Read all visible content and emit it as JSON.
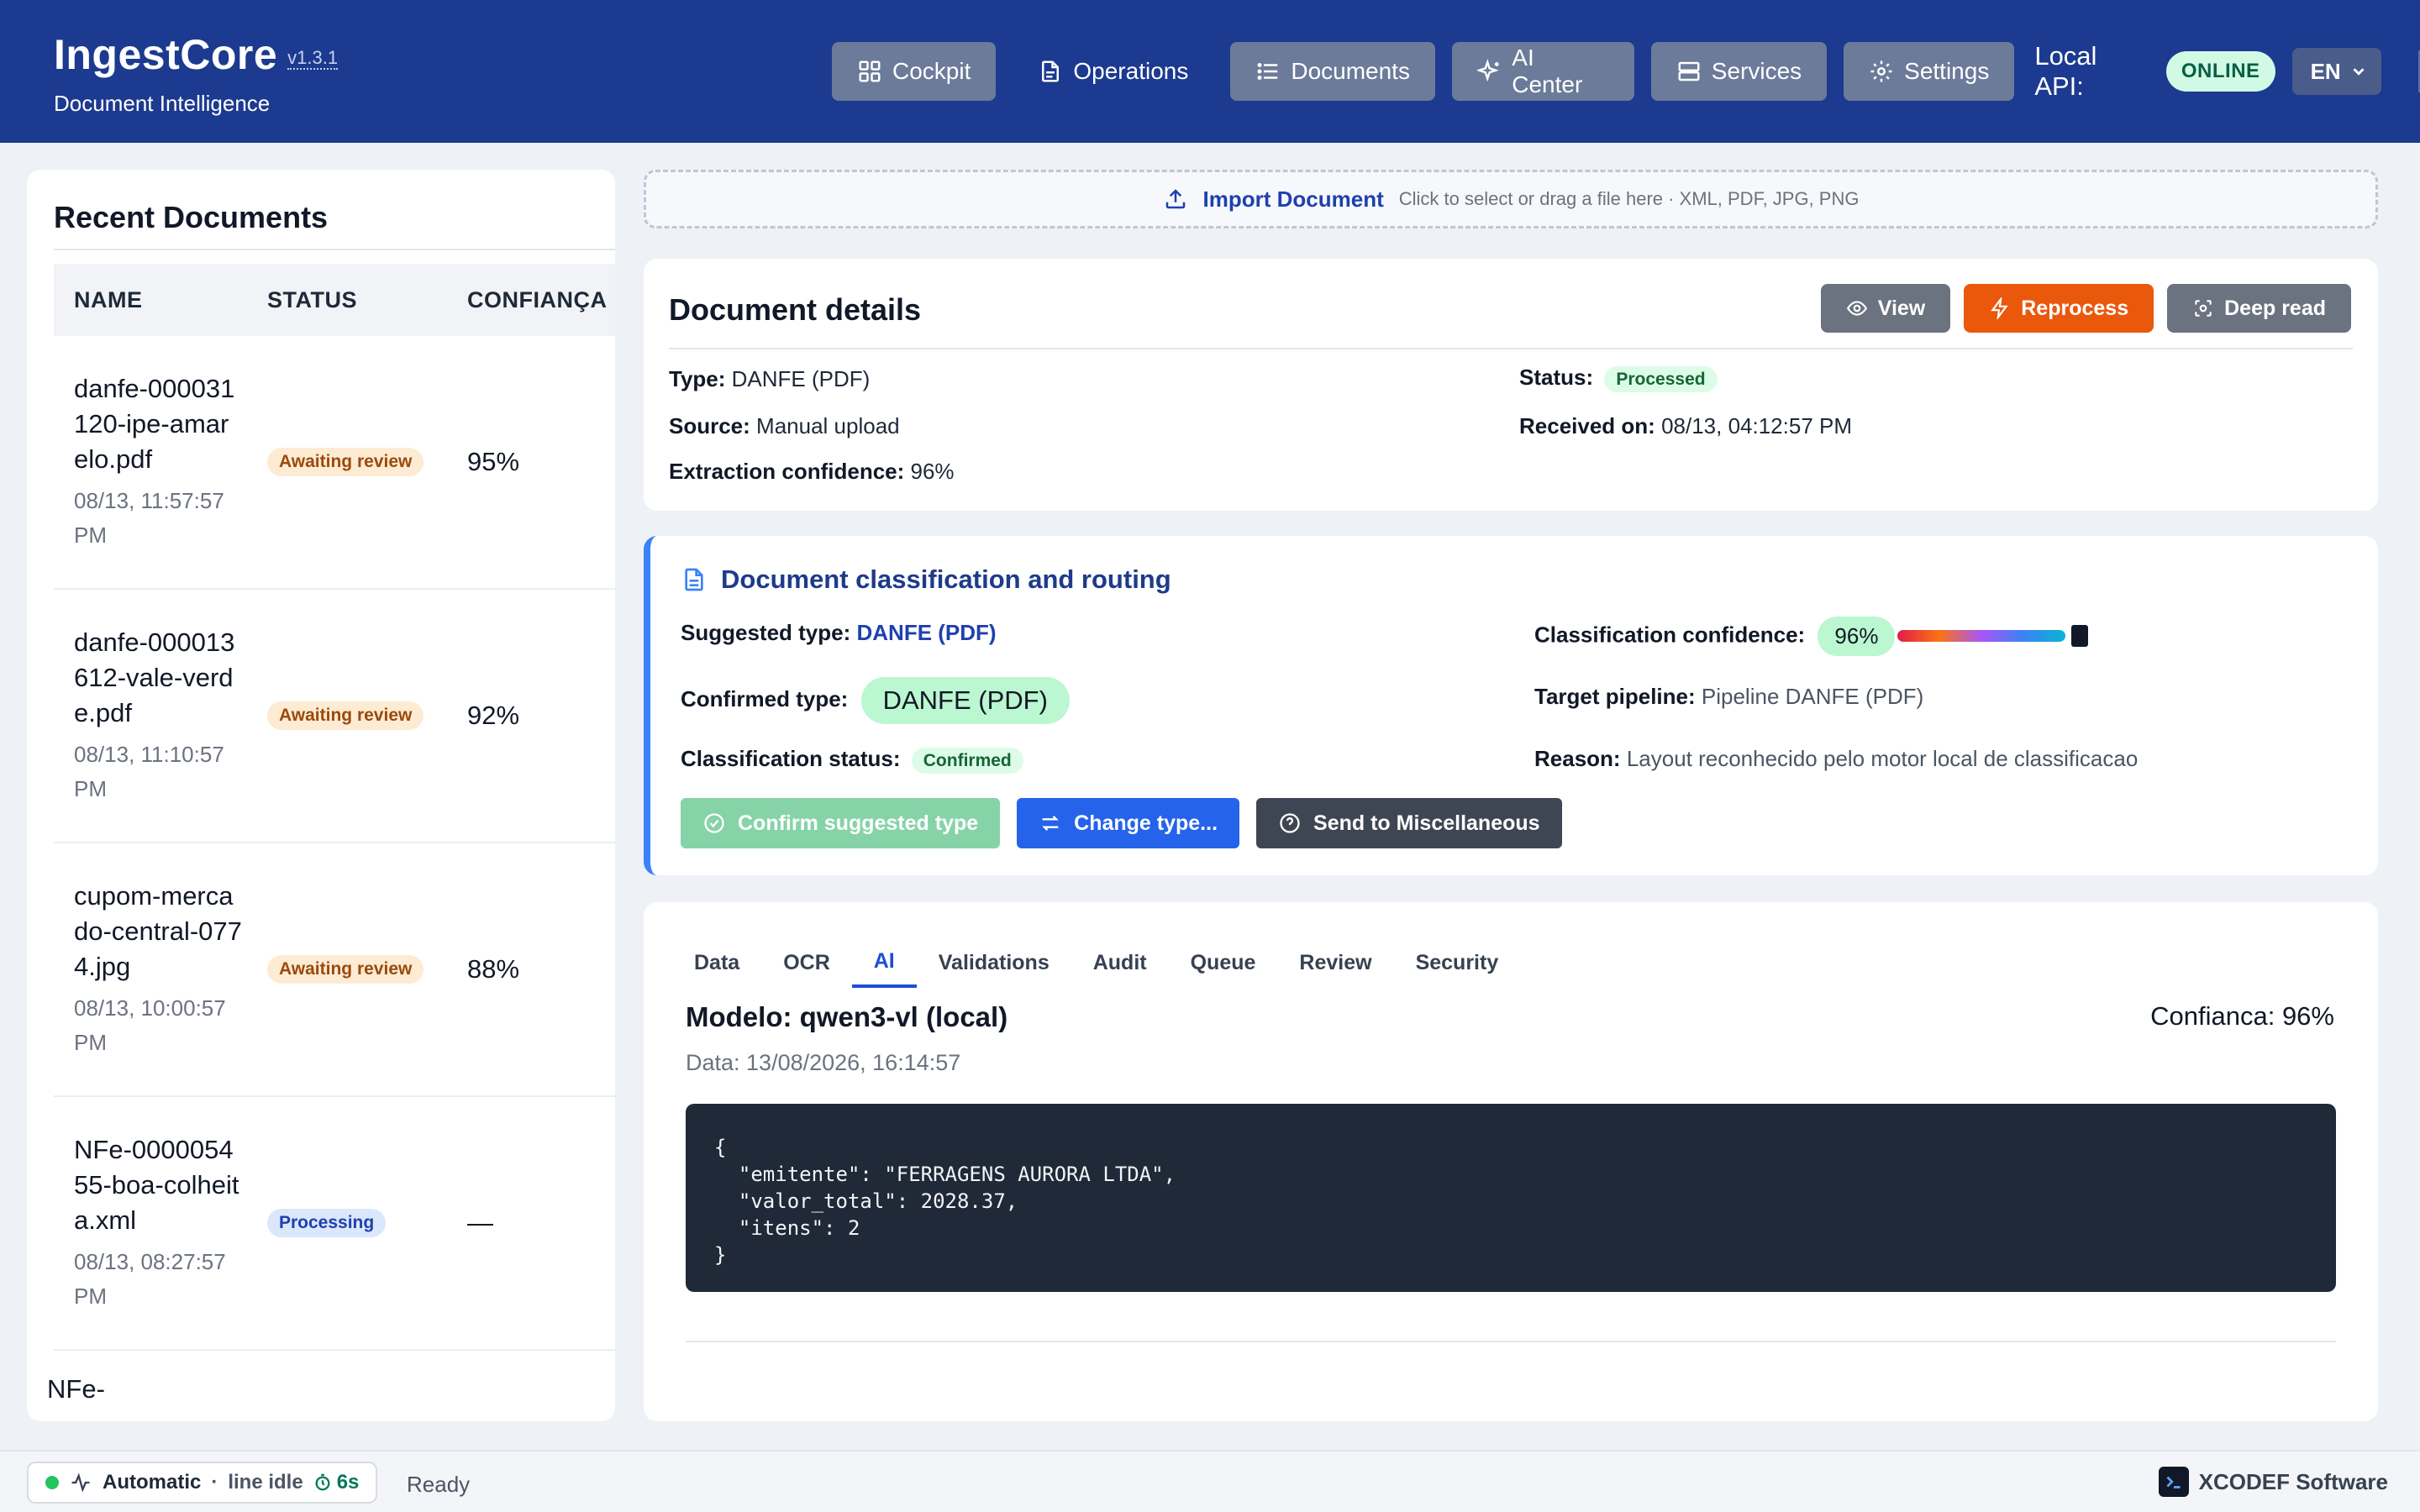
{
  "app": {
    "title": "IngestCore",
    "version": "v1.3.1",
    "subtitle": "Document Intelligence"
  },
  "nav": {
    "items": [
      {
        "label": "Cockpit",
        "icon": "grid-icon"
      },
      {
        "label": "Operations",
        "icon": "file-icon"
      },
      {
        "label": "Documents",
        "icon": "list-icon"
      },
      {
        "label": "AI Center",
        "icon": "sparkles-icon"
      },
      {
        "label": "Services",
        "icon": "server-icon"
      },
      {
        "label": "Settings",
        "icon": "gear-icon"
      }
    ],
    "active": "Operations",
    "api_label": "Local API:",
    "api_status": "ONLINE",
    "language": "EN"
  },
  "recent": {
    "title": "Recent Documents",
    "columns": [
      "NAME",
      "STATUS",
      "CONFIANÇA"
    ],
    "rows": [
      {
        "name": "danfe-000031120-ipe-amarelo.pdf",
        "date": "08/13, 11:57:57 PM",
        "status": "Awaiting review",
        "confidence": "95%"
      },
      {
        "name": "danfe-000013612-vale-verde.pdf",
        "date": "08/13, 11:10:57 PM",
        "status": "Awaiting review",
        "confidence": "92%"
      },
      {
        "name": "cupom-mercado-central-0774.jpg",
        "date": "08/13, 10:00:57 PM",
        "status": "Awaiting review",
        "confidence": "88%"
      },
      {
        "name": "NFe-000005455-boa-colheita.xml",
        "date": "08/13, 08:27:57 PM",
        "status": "Processing",
        "confidence": "—"
      }
    ],
    "partial_next": "NFe-"
  },
  "import": {
    "label": "Import Document",
    "hint": "Click to select or drag a file here · XML, PDF, JPG, PNG"
  },
  "details": {
    "title": "Document details",
    "actions": {
      "view": "View",
      "reprocess": "Reprocess",
      "deep_read": "Deep read"
    },
    "type_label": "Type:",
    "type_value": "DANFE (PDF)",
    "source_label": "Source:",
    "source_value": "Manual upload",
    "extraction_label": "Extraction confidence:",
    "extraction_value": "96%",
    "status_label": "Status:",
    "status_value": "Processed",
    "received_label": "Received on:",
    "received_value": "08/13, 04:12:57 PM"
  },
  "classification": {
    "title": "Document classification and routing",
    "suggested_label": "Suggested type:",
    "suggested_value": "DANFE (PDF)",
    "confirmed_label": "Confirmed type:",
    "confirmed_value": "DANFE (PDF)",
    "status_label": "Classification status:",
    "status_value": "Confirmed",
    "confidence_label": "Classification confidence:",
    "confidence_value": "96%",
    "confidence_fraction": 0.96,
    "pipeline_label": "Target pipeline:",
    "pipeline_value": "Pipeline DANFE (PDF)",
    "reason_label": "Reason:",
    "reason_value": "Layout reconhecido pelo motor local de classificacao",
    "actions": {
      "confirm": "Confirm suggested type",
      "change": "Change type...",
      "misc": "Send to Miscellaneous"
    }
  },
  "tabs": {
    "items": [
      "Data",
      "OCR",
      "AI",
      "Validations",
      "Audit",
      "Queue",
      "Review",
      "Security"
    ],
    "active": "AI"
  },
  "ai": {
    "model": "Modelo: qwen3-vl (local)",
    "confidence": "Confianca: 96%",
    "date": "Data: 13/08/2026, 16:14:57",
    "json_output": "{\n  \"emitente\": \"FERRAGENS AURORA LTDA\",\n  \"valor_total\": 2028.37,\n  \"itens\": 2\n}"
  },
  "footer": {
    "mode": "Automatic",
    "separator": "·",
    "line_state": "line idle",
    "timer": "6s",
    "ready": "Ready",
    "vendor": "XCODEF Software"
  },
  "colors": {
    "header": "#1c3a8f",
    "accent_orange": "#ea580c",
    "accent_blue": "#2563eb",
    "success": "#22c55e"
  }
}
